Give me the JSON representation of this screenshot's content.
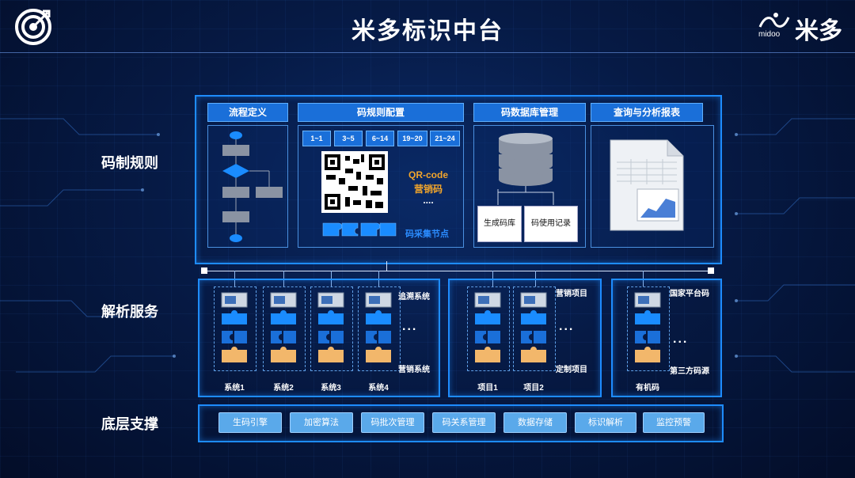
{
  "header": {
    "title": "米多标识中台",
    "brand_name": "米多",
    "brand_sub": "midoo"
  },
  "rows": {
    "rules": "码制规则",
    "parse": "解析服务",
    "base": "底层支撑"
  },
  "top": {
    "flow_title": "流程定义",
    "rule_title": "码规则配置",
    "db_title": "码数据库管理",
    "report_title": "查询与分析报表",
    "chips": [
      "1~1",
      "3~5",
      "6~14",
      "19~20",
      "21~24"
    ],
    "qr_label_1": "QR-code",
    "qr_label_2": "营销码",
    "qr_dots": "....",
    "collect_label": "码采集节点",
    "db_box_1": "生成码库",
    "db_box_2": "码使用记录"
  },
  "middle": {
    "group1": {
      "modules": [
        "系统1",
        "系统2",
        "系统3",
        "系统4"
      ],
      "side_top": "追溯系统",
      "side_bottom": "营销系统",
      "ellipsis": "..."
    },
    "group2": {
      "modules": [
        "项目1",
        "项目2"
      ],
      "side_top": "营销项目",
      "side_bottom": "定制项目",
      "ellipsis": "..."
    },
    "group3": {
      "modules": [
        "有机码"
      ],
      "side_top": "国家平台码",
      "side_bottom": "第三方码源",
      "ellipsis": "..."
    }
  },
  "bottom": {
    "items": [
      "生码引擎",
      "加密算法",
      "码批次管理",
      "码关系管理",
      "数据存储",
      "标识解析",
      "监控预警"
    ]
  },
  "colors": {
    "accent": "#1e8cff",
    "header_fill": "#1a6fd9",
    "orange": "#f2a52b",
    "bottom_btn": "#5aa9ea"
  }
}
